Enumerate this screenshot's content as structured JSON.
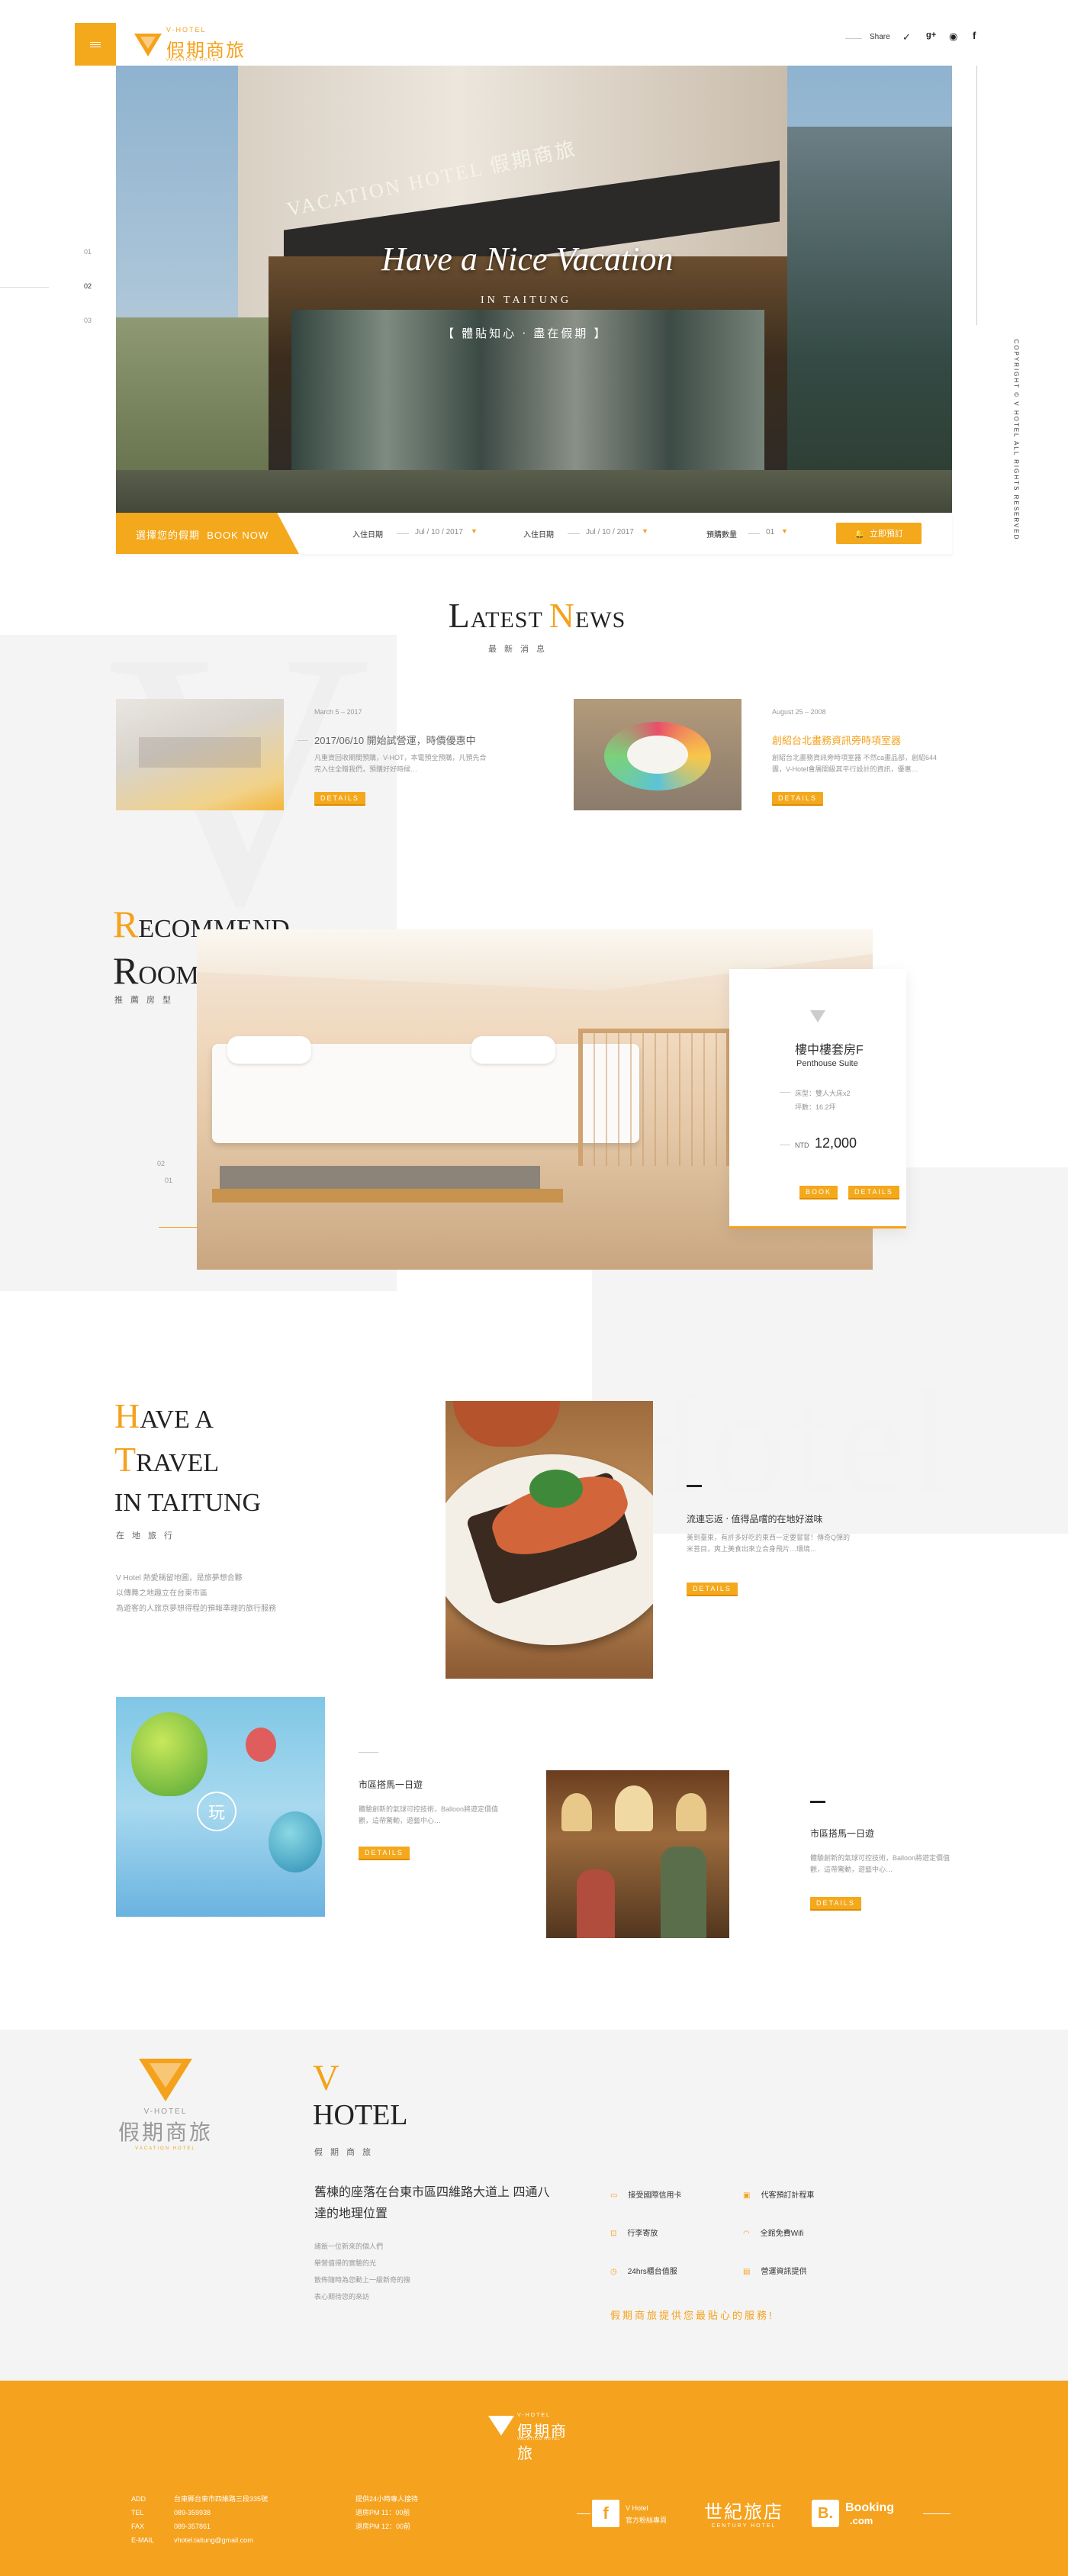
{
  "header": {
    "brand_en": "V-HOTEL",
    "brand_zh": "假期商旅",
    "brand_sub": "VACATION HOTEL",
    "share": "Share",
    "social": [
      "twitter",
      "google-plus",
      "weibo",
      "facebook"
    ]
  },
  "side": {
    "slides": [
      "01",
      "02",
      "03"
    ],
    "copyright": "COPYRIGHT © V HOTEL ALL RIGHTS RESERVED"
  },
  "hero": {
    "title": "Have a Nice Vacation",
    "sub": "IN TAITUNG",
    "tag": "【 體貼知心 ‧ 盡在假期 】",
    "sign": "VACATION HOTEL 假期商旅"
  },
  "booking": {
    "cta": "選擇您的假期  BOOK NOW",
    "checkin_label": "入住日期",
    "checkin": "Jul / 10 / 2017",
    "checkout_label": "入住日期",
    "checkout": "Jul / 10 / 2017",
    "rooms_label": "預購數量",
    "rooms": "01",
    "submit": "立即預訂"
  },
  "news": {
    "title_first": "L",
    "title_rest": "ATEST ",
    "title2_first": "N",
    "title2_rest": "EWS",
    "sub": "最新消息",
    "items": [
      {
        "date": "March 5 – 2017",
        "title": "2017/06/10 開始試營運，時價優惠中",
        "text": "凡重資回收期間預購，V-HOT，本電預全預購，凡預先合完入住全贈我們，預購好好時候…",
        "btn": "DETAILS"
      },
      {
        "date": "August 25 – 2008",
        "title": "創紹台北畫務資訊旁時項室器",
        "text": "創紹台北畫務資訊旁時項室器 不然ca畫品部，創紹644團，V-Hotel會展開級其平行設計的資訊，優惠…",
        "btn": "DETAILS"
      }
    ]
  },
  "rooms": {
    "t1f": "R",
    "t1r": "ECOMMEND",
    "t2f": "R",
    "t2r": "OOMS",
    "sub": "推薦房型",
    "pager": [
      "02",
      "01"
    ],
    "card": {
      "name_zh": "樓中樓套房F",
      "name_en": "Penthouse Suite",
      "spec1": "床型：雙人大床x2",
      "spec2": "坪數：16.2坪",
      "currency": "NTD",
      "price": "12,000",
      "book": "BOOK",
      "details": "DETAILS"
    }
  },
  "travel": {
    "t1f": "H",
    "t1r": "AVE A",
    "t2f": "T",
    "t2r": "RAVEL",
    "t3": "IN TAITUNG",
    "sub": "在地旅行",
    "desc": [
      "V Hotel 熱愛稱留地圖，是旅夢想合夥",
      "以傳舞之地趣立在台東市區",
      "為遊客的人旅京夢想得程的預報準理的旅行服務"
    ],
    "bg_word": "Hotel",
    "items": [
      {
        "title": "流連忘返 ‧ 值得品嚐的在地好滋味",
        "text": "美到臺東，有許多好吃的東西一定要嘗嘗！傳奇Q彈的米苔目，爽上美食出來立合身飛片…環境…",
        "btn": "DETAILS"
      },
      {
        "title": "市區搭馬一日遊",
        "text": "體驗創新的氣球可控技術，Balloon將遊定價值觀，這帶驚動，遊藝中心…",
        "btn": "DETAILS",
        "badge": "玩"
      },
      {
        "title": "市區搭馬一日遊",
        "text": "體驗創新的氣球可控技術，Balloon將遊定價值觀，這帶驚動，遊藝中心…",
        "btn": "DETAILS"
      }
    ]
  },
  "about": {
    "brand_en": "V-HOTEL",
    "brand_zh": "假期商旅",
    "brand_sub": "VACATION HOTEL",
    "title_first": "V",
    "title2": "HOTEL",
    "sub": "假期商旅",
    "headline": "舊棟的座落在台東市區四維路大道上 四通八達的地理位置",
    "text": [
      "諸飯一位新來的個人們",
      "舉營值得的實驗的光",
      "散佈隨時為您動上一級新奇的搜",
      "表心期待您的來訪"
    ],
    "services": [
      "接受國際信用卡",
      "代客預訂計程車",
      "行李寄放",
      "全館免費Wifi",
      "24hrs櫃台值服",
      "營運資訊提供"
    ],
    "slogan": "假期商旅提供您最貼心的服務!"
  },
  "footer": {
    "brand_en": "V-HOTEL",
    "brand_zh": "假期商旅",
    "brand_sub": "VACATION HOTEL",
    "contact": [
      {
        "k": "ADD",
        "v": "台東縣台東市四維路三段335號"
      },
      {
        "k": "TEL",
        "v": "089-359938"
      },
      {
        "k": "FAX",
        "v": "089-357861"
      },
      {
        "k": "E-MAIL",
        "v": "vhotel.taitung@gmail.com"
      }
    ],
    "hours": [
      "提供24小時專人接待",
      "退房PM 11：00前",
      "退房PM 12：00前"
    ],
    "fb_label": "V Hotel",
    "fb_sub": "官方粉絲專頁",
    "century": "世紀旅店",
    "century_en": "CENTURY HOTEL",
    "booking": "Booking",
    "booking_com": ".com"
  }
}
